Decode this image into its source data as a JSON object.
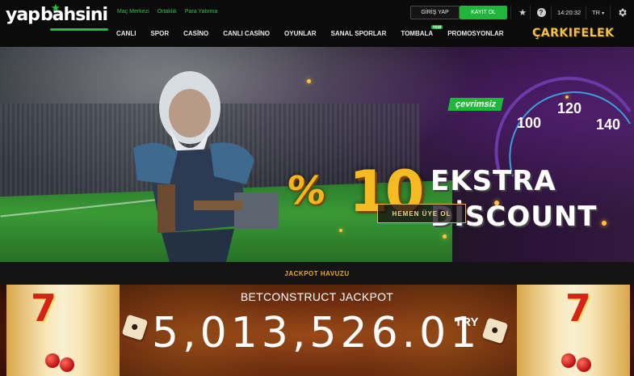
{
  "header": {
    "logo": {
      "part1": "yap",
      "part2": "bahsini"
    },
    "top_links": [
      "Maç Merkezi",
      "Ortaklık",
      "Para Yatırma"
    ],
    "login_label": "GİRİŞ YAP",
    "register_label": "KAYIT OL",
    "clock": "14:20:32",
    "language": "TR",
    "nav": [
      {
        "label": "CANLI"
      },
      {
        "label": "SPOR"
      },
      {
        "label": "CASİNO"
      },
      {
        "label": "CANLI CASİNO"
      },
      {
        "label": "OYUNLAR"
      },
      {
        "label": "SANAL SPORLAR"
      },
      {
        "label": "TOMBALA",
        "badge": "YENİ"
      },
      {
        "label": "PROMOSYONLAR"
      }
    ],
    "wheel_link": "ÇARKIFELEK",
    "icons": [
      "star-icon",
      "help-icon",
      "gear-icon"
    ]
  },
  "banner": {
    "tag": "çevrimsiz",
    "percent_sign": "%",
    "number": "10",
    "line1": "EKSTRA",
    "line2": "DİSCOUNT",
    "cta_label": "HEMEN ÜYE OL",
    "speed_values": [
      "100",
      "120",
      "140"
    ]
  },
  "jackpot": {
    "section_title": "JACKPOT HAVUZU",
    "name": "BETCONSTRUCT JACKPOT",
    "amount": "5,013,52",
    "amount_rolling": "6.01",
    "currency": "TRY"
  },
  "colors": {
    "brand_green": "#1fb63b",
    "accent_gold": "#f4b51e",
    "jackpot_title": "#f0a72a"
  }
}
